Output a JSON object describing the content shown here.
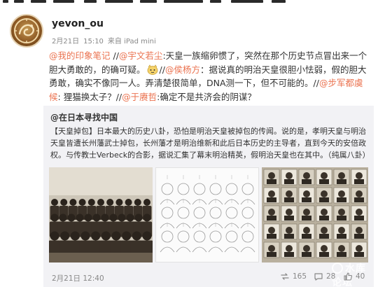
{
  "post": {
    "username": "yevon_ou",
    "date": "2月21日",
    "time": "15:10",
    "source": "来自 iPad mini",
    "comment_parts": [
      {
        "t": "@我的印象笔记",
        "m": true
      },
      {
        "t": " //",
        "m": false
      },
      {
        "t": "@宇文若尘",
        "m": true
      },
      {
        "t": ":天皇一族缩卵惯了，突然在那个历史节点冒出来一个胆大勇敢的，的确可疑。",
        "m": false
      },
      {
        "t": "face",
        "m": false
      },
      {
        "t": "//",
        "m": false
      },
      {
        "t": "@侯杨方",
        "m": true
      },
      {
        "t": "：据说真的明治天皇很胆小怯弱，假的胆大勇敢，确实不像同一人。弄清楚很简单，DNA测一下，但不可能的。//",
        "m": false
      },
      {
        "t": "@步军都虞候",
        "m": true
      },
      {
        "t": ": 狸猫换太子？//",
        "m": false
      },
      {
        "t": "@于赓哲",
        "m": true
      },
      {
        "t": ":确定不是共济会的阴谋？",
        "m": false
      }
    ]
  },
  "repost": {
    "author": "@在日本寻找中国",
    "text": "【天皇掉包】日本最大的历史八卦，恐怕是明治天皇被掉包的传闻。说的是，孝明天皇与明治天皇皆遭长州藩武士掉包，长州藩才是明治维新和此后日本历史的主导者，直到今天的安倍政权。与传教士Verbeck的合影，据说汇集了幕末明治精英，假明治天皇也在其中。（纯属八卦）",
    "time": "2月21日 12:40",
    "reposts": "165",
    "comments": "28",
    "likes": "40",
    "watermark": "水库论坛"
  },
  "colors": {
    "mention": "#eb7350",
    "repost_bg": "#f2f2f5",
    "text": "#333333",
    "meta": "#888888"
  },
  "icons": {
    "repost": "repost-icon",
    "comment": "comment-icon",
    "like": "like-icon",
    "face": "face-icon",
    "watermark": "watermark-logo-icon"
  }
}
